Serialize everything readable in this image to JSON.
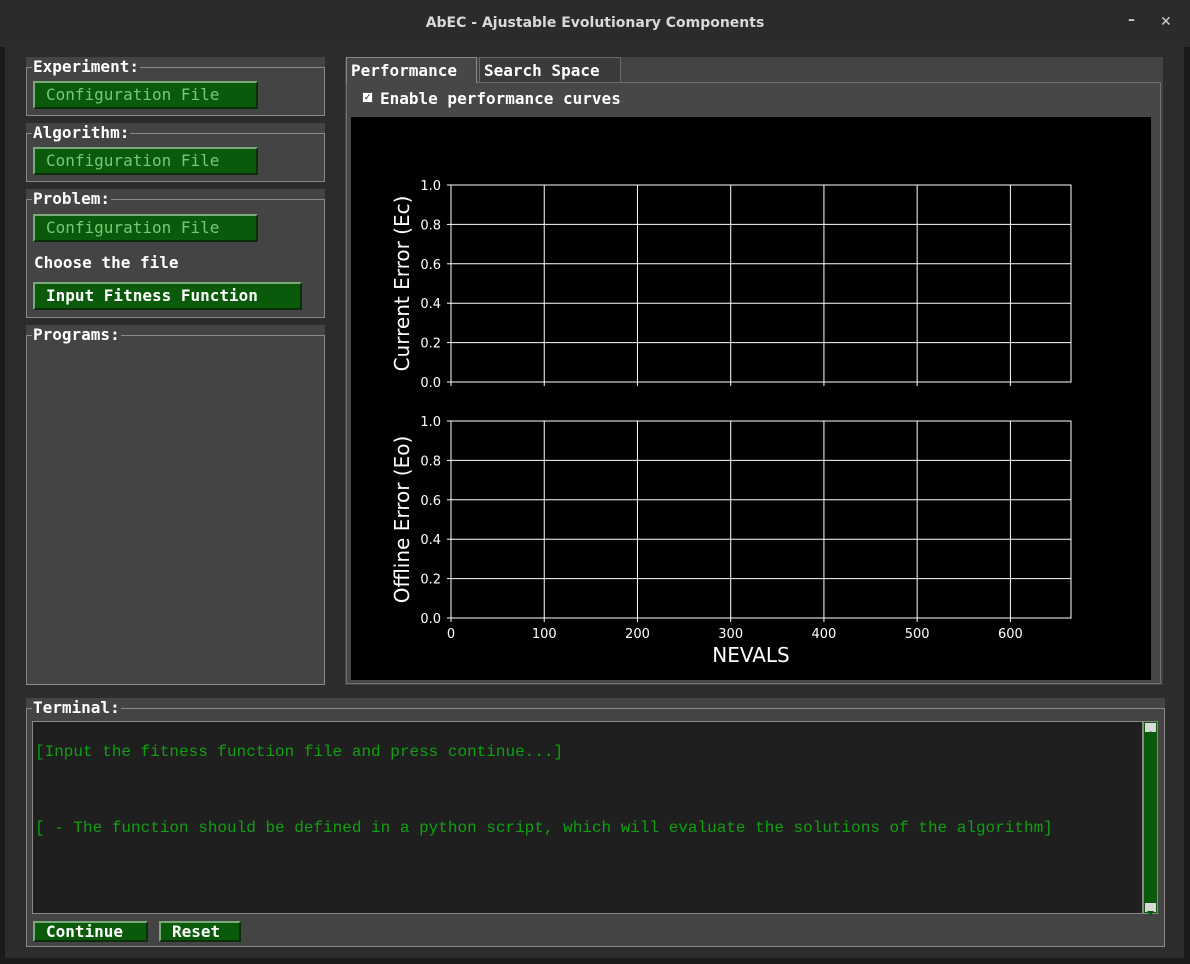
{
  "window": {
    "title": "AbEC - Ajustable Evolutionary Components",
    "minimize_glyph": "–",
    "close_glyph": "✕"
  },
  "left_panel": {
    "experiment": {
      "label": "Experiment:",
      "button": "Configuration File"
    },
    "algorithm": {
      "label": "Algorithm:",
      "button": "Configuration File"
    },
    "problem": {
      "label": "Problem:",
      "button": "Configuration File",
      "hint": "Choose the file",
      "fitness_button": "Input Fitness Function"
    },
    "programs": {
      "label": "Programs:"
    }
  },
  "tabs": [
    {
      "label": "Performance",
      "active": true
    },
    {
      "label": "Search Space",
      "active": false
    }
  ],
  "performance": {
    "enable_label": "Enable performance curves",
    "enabled": true,
    "check_glyph": "✓"
  },
  "chart_data": [
    {
      "type": "line",
      "ylabel": "Current Error (Ec)",
      "xlim": [
        0,
        665
      ],
      "ylim": [
        0,
        1.0
      ],
      "xticks": [
        0,
        100,
        200,
        300,
        400,
        500,
        600
      ],
      "yticks": [
        "0.0",
        "0.2",
        "0.4",
        "0.6",
        "0.8",
        "1.0"
      ],
      "grid": true,
      "series": []
    },
    {
      "type": "line",
      "xlabel": "NEVALS",
      "ylabel": "Offline Error (Eo)",
      "xlim": [
        0,
        665
      ],
      "ylim": [
        0,
        1.0
      ],
      "xticks": [
        0,
        100,
        200,
        300,
        400,
        500,
        600
      ],
      "yticks": [
        "0.0",
        "0.2",
        "0.4",
        "0.6",
        "0.8",
        "1.0"
      ],
      "grid": true,
      "series": []
    }
  ],
  "terminal": {
    "label": "Terminal:",
    "lines": [
      "[Input the fitness function file and press continue...]",
      "",
      "[ - The function should be defined in a python script, which will evaluate the solutions of the algorithm]"
    ],
    "continue": "Continue",
    "reset": "Reset"
  },
  "colors": {
    "button_green": "#0b5a0b",
    "terminal_text": "#10a010",
    "plot_bg": "#000000",
    "grid": "#ffffff"
  }
}
